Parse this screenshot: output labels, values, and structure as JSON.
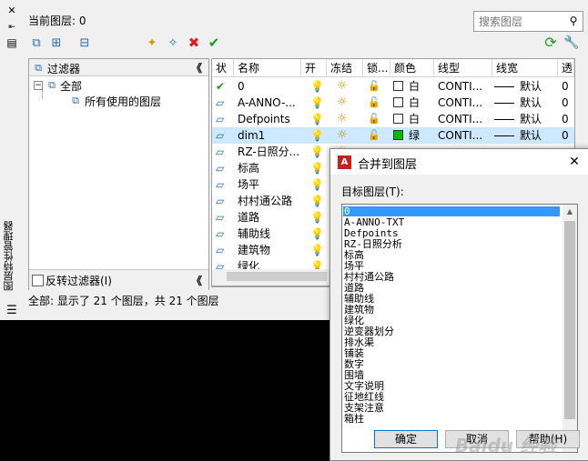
{
  "current_layer": {
    "label": "当前图层: 0"
  },
  "search": {
    "placeholder": "搜索图层"
  },
  "strip": {
    "title": "图层特性管理器"
  },
  "filters": {
    "header": "过滤器",
    "tree_root": "全部",
    "tree_child": "所有使用的图层",
    "invert_label": "反转过滤器(I)",
    "collapse_glyph": "《"
  },
  "table": {
    "columns": [
      "状",
      "名称",
      "开",
      "冻结",
      "锁...",
      "颜色",
      "线型",
      "线宽",
      "透"
    ],
    "rows": [
      {
        "status": "current",
        "name": "0",
        "color_name": "白",
        "color": "#ffffff",
        "linetype": "CONTI...",
        "lineweight": "默认",
        "transparency": "0"
      },
      {
        "status": "layer",
        "name": "A-ANNO-...",
        "color_name": "白",
        "color": "#ffffff",
        "linetype": "CONTI...",
        "lineweight": "默认",
        "transparency": "0"
      },
      {
        "status": "layer",
        "name": "Defpoints",
        "color_name": "白",
        "color": "#ffffff",
        "linetype": "CONTI...",
        "lineweight": "默认",
        "transparency": "0"
      },
      {
        "status": "layer",
        "name": "dim1",
        "color_name": "绿",
        "color": "#00c000",
        "linetype": "CONTI...",
        "lineweight": "默认",
        "transparency": "0"
      },
      {
        "status": "layer",
        "name": "RZ-日照分..."
      },
      {
        "status": "layer",
        "name": "标高"
      },
      {
        "status": "layer",
        "name": "场平"
      },
      {
        "status": "layer",
        "name": "村村通公路"
      },
      {
        "status": "layer",
        "name": "道路"
      },
      {
        "status": "layer",
        "name": "辅助线"
      },
      {
        "status": "layer",
        "name": "建筑物"
      },
      {
        "status": "layer",
        "name": "绿化"
      }
    ]
  },
  "status_bar": {
    "text": "全部: 显示了 21 个图层，共 21 个图层"
  },
  "dialog": {
    "title": "合并到图层",
    "target_label": "目标图层(T):",
    "items": [
      "0",
      "A-ANNO-TXT",
      "Defpoints",
      "RZ-日照分析",
      "标高",
      "场平",
      "村村通公路",
      "道路",
      "辅助线",
      "建筑物",
      "绿化",
      "逆变器划分",
      "排水渠",
      "铺装",
      "数字",
      "围墙",
      "文字说明",
      "征地红线",
      "支架注意",
      "箱柱"
    ],
    "ok": "确定",
    "cancel": "取消",
    "help": "帮助(H)"
  },
  "watermark": "Baidu 经验",
  "colors": {
    "selection": "#cde8ff",
    "list_selection": "#3399ff",
    "green": "#00c000",
    "red": "#e02020",
    "accent": "#2a6db0"
  }
}
